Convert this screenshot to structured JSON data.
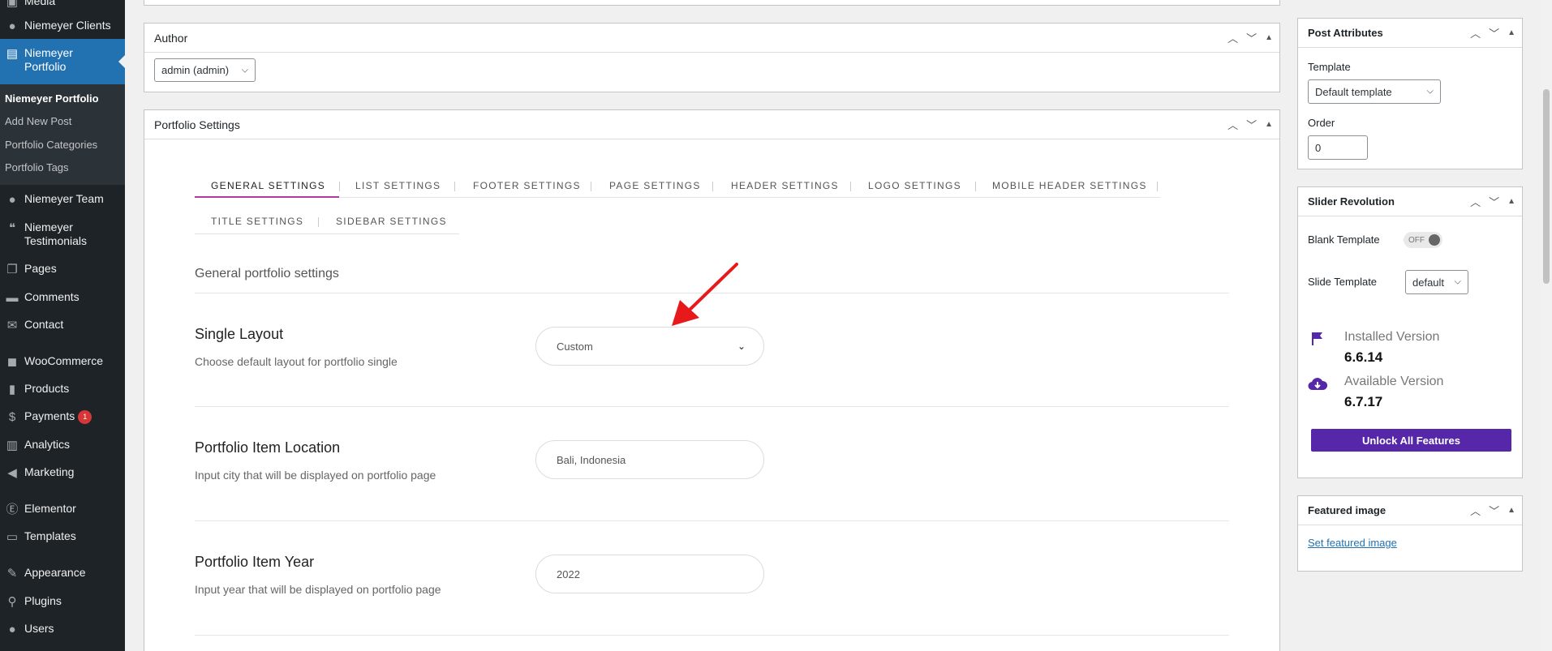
{
  "sidebar": {
    "items": [
      {
        "label": "Media",
        "icon": "media-icon"
      },
      {
        "label": "Niemeyer Clients",
        "icon": "clients-icon"
      },
      {
        "label": "Niemeyer Portfolio",
        "icon": "portfolio-icon"
      },
      {
        "label": "Niemeyer Team",
        "icon": "team-icon"
      },
      {
        "label": "Niemeyer Testimonials",
        "icon": "testimonials-icon"
      },
      {
        "label": "Pages",
        "icon": "pages-icon"
      },
      {
        "label": "Comments",
        "icon": "comments-icon"
      },
      {
        "label": "Contact",
        "icon": "contact-icon"
      },
      {
        "label": "WooCommerce",
        "icon": "woocommerce-icon"
      },
      {
        "label": "Products",
        "icon": "products-icon"
      },
      {
        "label": "Payments",
        "icon": "payments-icon",
        "badge": "1"
      },
      {
        "label": "Analytics",
        "icon": "analytics-icon"
      },
      {
        "label": "Marketing",
        "icon": "marketing-icon"
      },
      {
        "label": "Elementor",
        "icon": "elementor-icon"
      },
      {
        "label": "Templates",
        "icon": "templates-icon"
      },
      {
        "label": "Appearance",
        "icon": "appearance-icon"
      },
      {
        "label": "Plugins",
        "icon": "plugins-icon"
      },
      {
        "label": "Users",
        "icon": "users-icon"
      }
    ],
    "submenu": [
      "Niemeyer Portfolio",
      "Add New Post",
      "Portfolio Categories",
      "Portfolio Tags"
    ]
  },
  "author_box": {
    "title": "Author",
    "selected": "admin (admin)"
  },
  "portfolio_settings": {
    "title": "Portfolio Settings",
    "tabs": [
      "GENERAL SETTINGS",
      "LIST SETTINGS",
      "FOOTER SETTINGS",
      "PAGE SETTINGS",
      "HEADER SETTINGS",
      "LOGO SETTINGS",
      "MOBILE HEADER SETTINGS",
      "TITLE SETTINGS",
      "SIDEBAR SETTINGS"
    ],
    "section_title": "General portfolio settings",
    "fields": [
      {
        "title": "Single Layout",
        "description": "Choose default layout for portfolio single",
        "value": "Custom"
      },
      {
        "title": "Portfolio Item Location",
        "description": "Input city that will be displayed on portfolio page",
        "value": "Bali, Indonesia"
      },
      {
        "title": "Portfolio Item Year",
        "description": "Input year that will be displayed on portfolio page",
        "value": "2022"
      }
    ]
  },
  "post_attributes": {
    "title": "Post Attributes",
    "template_label": "Template",
    "template_value": "Default template",
    "order_label": "Order",
    "order_value": "0"
  },
  "slider_revolution": {
    "title": "Slider Revolution",
    "blank_template_label": "Blank Template",
    "blank_template_toggle": "OFF",
    "slide_template_label": "Slide Template",
    "slide_template_value": "default",
    "installed_label": "Installed Version",
    "installed_value": "6.6.14",
    "available_label": "Available Version",
    "available_value": "6.7.17",
    "unlock_button": "Unlock All Features"
  },
  "featured_image": {
    "title": "Featured image",
    "link": "Set featured image"
  },
  "colors": {
    "sidebar_bg": "#1d2327",
    "active_menu": "#2271b1",
    "purple": "#5627a8",
    "annotation_arrow": "#e8191b"
  }
}
